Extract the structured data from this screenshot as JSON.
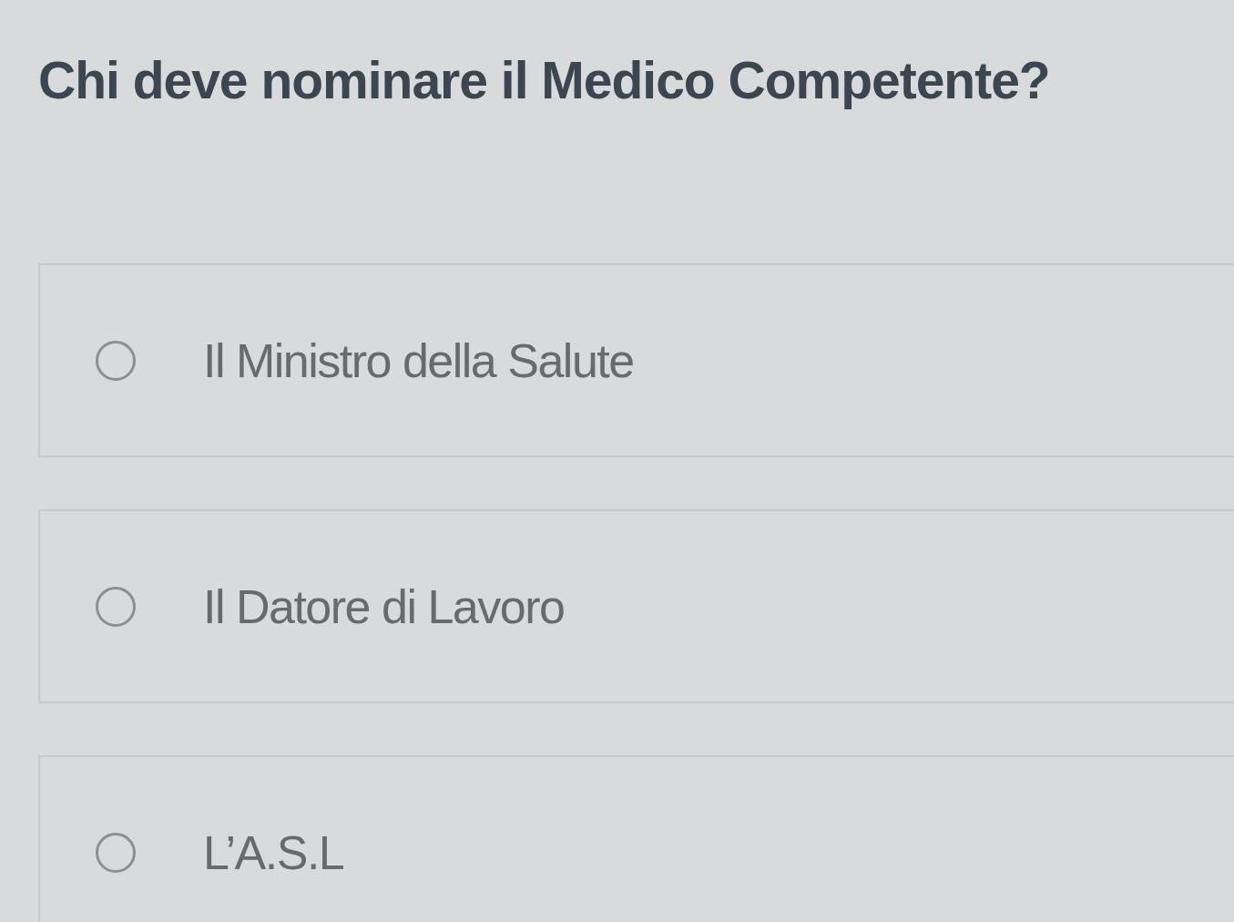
{
  "question": {
    "title": "Chi deve nominare il Medico Competente?"
  },
  "options": [
    {
      "label": "Il Ministro della Salute",
      "selected": false
    },
    {
      "label": "Il Datore di Lavoro",
      "selected": false
    },
    {
      "label": "L’A.S.L",
      "selected": false
    }
  ]
}
